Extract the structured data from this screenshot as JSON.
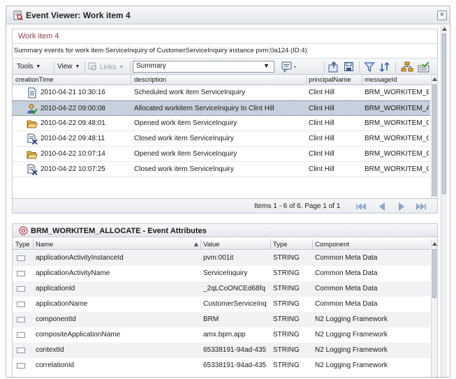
{
  "window": {
    "title": "Event Viewer: Work item 4",
    "close_glyph": "×"
  },
  "workitem": {
    "title": "Work item 4",
    "summary": "Summary events for work item ServiceInquiry of CustomerServiceInquiry instance pvm:0a124 (ID:4)"
  },
  "toolbar": {
    "tools_label": "Tools",
    "view_label": "View",
    "links_label": "Links",
    "filter_value": "Summary"
  },
  "events_grid": {
    "columns": [
      "creationTime",
      "description",
      "principalName",
      "messageId"
    ],
    "rows": [
      {
        "icon": "document-icon",
        "time": "2010-04-21 10:30:16",
        "description": "Scheduled work item ServiceInquiry",
        "principal": "Clint Hill",
        "message": "BRM_WORKITEM_E"
      },
      {
        "icon": "user-check-icon",
        "time": "2010-04-22 09:00:08",
        "description": "Allocated workitem ServiceInquiry to Clint Hill",
        "principal": "Clint Hill",
        "message": "BRM_WORKITEM_A"
      },
      {
        "icon": "folder-open-icon",
        "time": "2010-04-22 09:48:01",
        "description": "Opened work item ServiceInquiry",
        "principal": "Clint Hill",
        "message": "BRM_WORKITEM_C"
      },
      {
        "icon": "document-closed-icon",
        "time": "2010-04-22 09:48:11",
        "description": "Closed work item ServiceInquiry",
        "principal": "Clint Hill",
        "message": "BRM_WORKITEM_C"
      },
      {
        "icon": "folder-open-icon",
        "time": "2010-04-22 10:07:14",
        "description": "Opened work item ServiceInquiry",
        "principal": "Clint Hill",
        "message": "BRM_WORKITEM_C"
      },
      {
        "icon": "document-closed-icon",
        "time": "2010-04-22 10:07:25",
        "description": "Closed work item ServiceInquiry",
        "principal": "Clint Hill",
        "message": "BRM_WORKITEM_C"
      }
    ],
    "selected_index": 1
  },
  "pager": {
    "text": "Items 1 - 6 of 6. Page 1 of 1"
  },
  "attributes": {
    "title": "BRM_WORKITEM_ALLOCATE - Event Attributes",
    "columns": [
      "Type",
      "Name",
      "Value",
      "Type",
      "Component"
    ],
    "rows": [
      {
        "name": "applicationActivityInstanceId",
        "value": "pvm:001it",
        "type": "STRING",
        "component": "Common Meta Data"
      },
      {
        "name": "applicationActivityName",
        "value": "ServiceInquiry",
        "type": "STRING",
        "component": "Common Meta Data"
      },
      {
        "name": "applicationId",
        "value": "_2qLCoONCEd68fq",
        "type": "STRING",
        "component": "Common Meta Data"
      },
      {
        "name": "applicationName",
        "value": "CustomerServiceInq",
        "type": "STRING",
        "component": "Common Meta Data"
      },
      {
        "name": "componentId",
        "value": "BRM",
        "type": "STRING",
        "component": "N2 Logging Framework"
      },
      {
        "name": "compositeApplicationName",
        "value": "amx.bpm.app",
        "type": "STRING",
        "component": "N2 Logging Framework"
      },
      {
        "name": "contextId",
        "value": "65338191-94ad-435",
        "type": "STRING",
        "component": "N2 Logging Framework"
      },
      {
        "name": "correlationId",
        "value": "65338191-94ad-435",
        "type": "STRING",
        "component": "N2 Logging Framework"
      }
    ]
  },
  "colors": {
    "accent_title": "#8f3f4f",
    "selected_row": "#c7d1dd",
    "link_disabled": "#9aa1ab"
  }
}
